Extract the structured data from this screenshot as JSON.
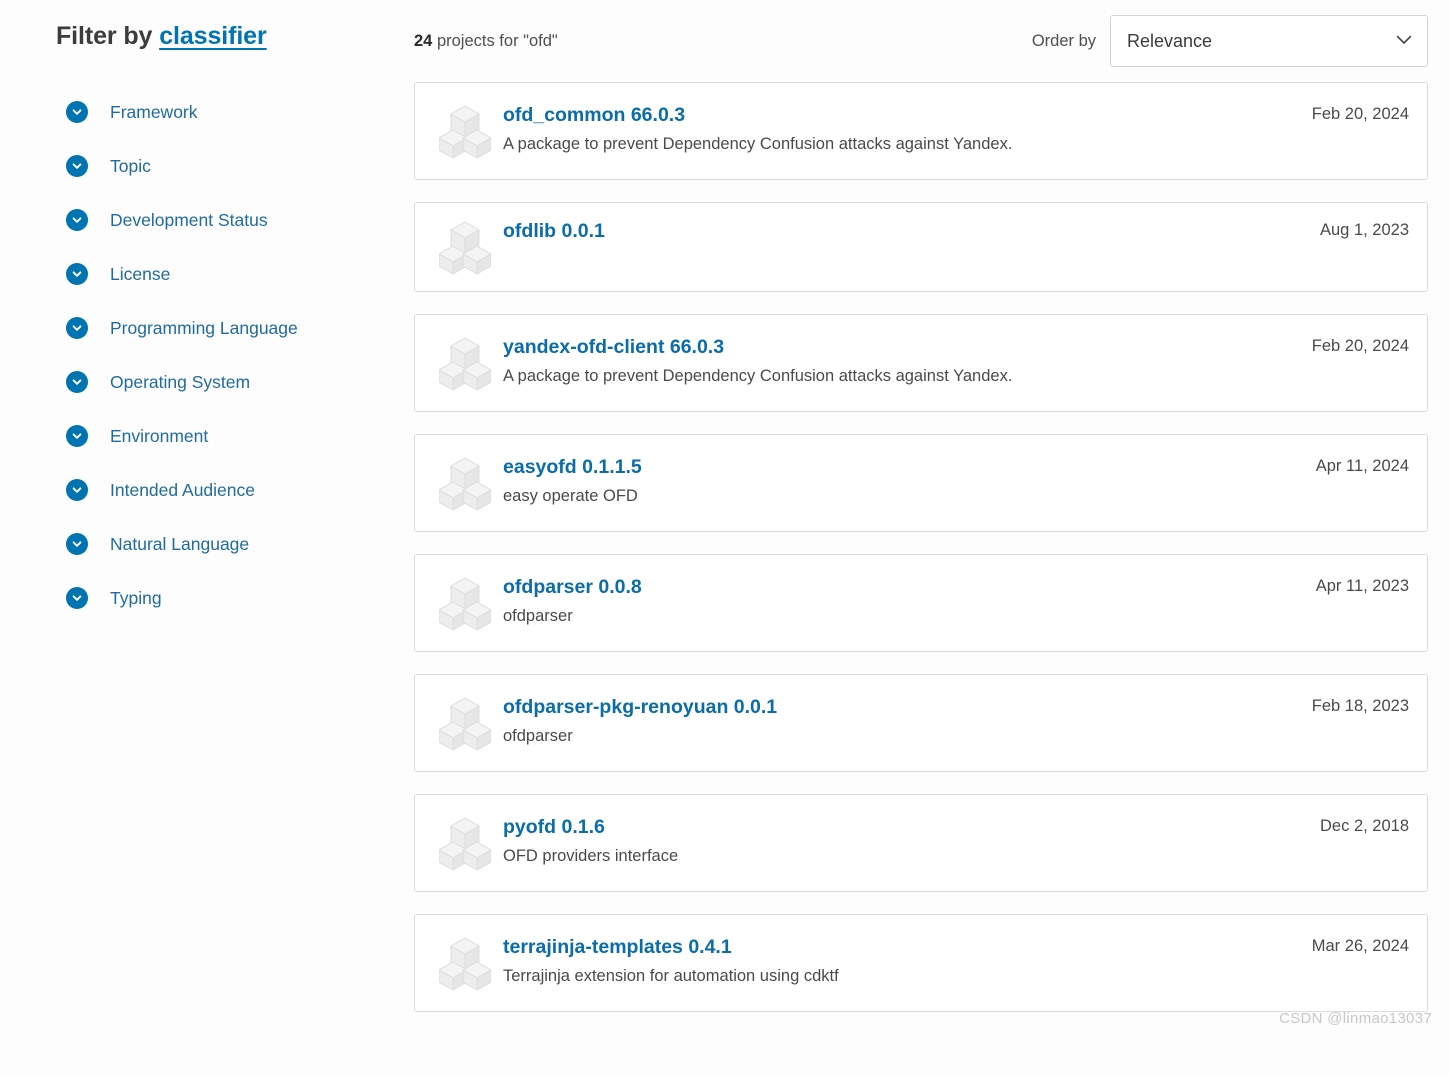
{
  "sidebar": {
    "heading_prefix": "Filter by ",
    "heading_link": "classifier",
    "items": [
      {
        "label": "Framework",
        "icon": "chevron-down-circle-icon"
      },
      {
        "label": "Topic",
        "icon": "chevron-down-circle-icon"
      },
      {
        "label": "Development Status",
        "icon": "chevron-down-circle-icon"
      },
      {
        "label": "License",
        "icon": "chevron-down-circle-icon"
      },
      {
        "label": "Programming Language",
        "icon": "chevron-down-circle-icon"
      },
      {
        "label": "Operating System",
        "icon": "chevron-down-circle-icon"
      },
      {
        "label": "Environment",
        "icon": "chevron-down-circle-icon"
      },
      {
        "label": "Intended Audience",
        "icon": "chevron-down-circle-icon"
      },
      {
        "label": "Natural Language",
        "icon": "chevron-down-circle-icon"
      },
      {
        "label": "Typing",
        "icon": "chevron-down-circle-icon"
      }
    ]
  },
  "results_header": {
    "count": "24",
    "count_suffix": " projects for \"ofd\"",
    "order_label": "Order by",
    "order_value": "Relevance",
    "order_options": [
      "Relevance"
    ],
    "chevron_icon": "chevron-down-icon"
  },
  "results": [
    {
      "name": "ofd_common",
      "version": "66.0.3",
      "title": "ofd_common 66.0.3",
      "description": "A package to prevent Dependency Confusion attacks against Yandex.",
      "date": "Feb 20, 2024",
      "icon": "package-cubes-icon"
    },
    {
      "name": "ofdlib",
      "version": "0.0.1",
      "title": "ofdlib 0.0.1",
      "description": "",
      "date": "Aug 1, 2023",
      "icon": "package-cubes-icon"
    },
    {
      "name": "yandex-ofd-client",
      "version": "66.0.3",
      "title": "yandex-ofd-client 66.0.3",
      "description": "A package to prevent Dependency Confusion attacks against Yandex.",
      "date": "Feb 20, 2024",
      "icon": "package-cubes-icon"
    },
    {
      "name": "easyofd",
      "version": "0.1.1.5",
      "title": "easyofd 0.1.1.5",
      "description": "easy operate OFD",
      "date": "Apr 11, 2024",
      "icon": "package-cubes-icon"
    },
    {
      "name": "ofdparser",
      "version": "0.0.8",
      "title": "ofdparser 0.0.8",
      "description": "ofdparser",
      "date": "Apr 11, 2023",
      "icon": "package-cubes-icon"
    },
    {
      "name": "ofdparser-pkg-renoyuan",
      "version": "0.0.1",
      "title": "ofdparser-pkg-renoyuan 0.0.1",
      "description": "ofdparser",
      "date": "Feb 18, 2023",
      "icon": "package-cubes-icon"
    },
    {
      "name": "pyofd",
      "version": "0.1.6",
      "title": "pyofd 0.1.6",
      "description": "OFD providers interface",
      "date": "Dec 2, 2018",
      "icon": "package-cubes-icon"
    },
    {
      "name": "terrajinja-templates",
      "version": "0.4.1",
      "title": "terrajinja-templates 0.4.1",
      "description": "Terrajinja extension for automation using cdktf",
      "date": "Mar 26, 2024",
      "icon": "package-cubes-icon"
    }
  ],
  "watermark": "CSDN @linmao13037",
  "colors": {
    "accent_blue": "#0073b1",
    "link_blue": "#0a6ca8",
    "sidebar_link": "#206b9f",
    "text": "#2b2b2b",
    "muted_text": "#4a4a4a",
    "card_border": "#dcdcdc",
    "page_bg": "#fdfdfd"
  }
}
